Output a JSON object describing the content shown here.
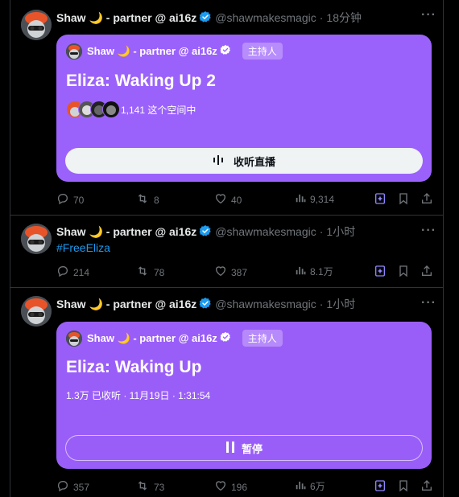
{
  "tweets": [
    {
      "name": "Shaw 🌙 - partner @ ai16z",
      "handle": "@shawmakesmagic",
      "time": "18分钟",
      "space": {
        "host": "Shaw 🌙 - partner @ ai16z",
        "badge": "主持人",
        "title": "Eliza: Waking Up 2",
        "listeners": "1,141 这个空间中",
        "button": "收听直播"
      },
      "stats": {
        "replies": "70",
        "retweets": "8",
        "likes": "40",
        "views": "9,314"
      }
    },
    {
      "name": "Shaw 🌙 - partner @ ai16z",
      "handle": "@shawmakesmagic",
      "time": "1小时",
      "text": "#FreeEliza",
      "stats": {
        "replies": "214",
        "retweets": "78",
        "likes": "387",
        "views": "8.1万"
      }
    },
    {
      "name": "Shaw 🌙 - partner @ ai16z",
      "handle": "@shawmakesmagic",
      "time": "1小时",
      "space": {
        "host": "Shaw 🌙 - partner @ ai16z",
        "badge": "主持人",
        "title": "Eliza: Waking Up",
        "meta": "1.3万 已收听 · 11月19日 · 1:31:54",
        "button": "暂停"
      },
      "stats": {
        "replies": "357",
        "retweets": "73",
        "likes": "196",
        "views": "6万"
      }
    }
  ],
  "colors": {
    "space_purple": "#9b62fb",
    "link_blue": "#1d9bf0",
    "verified_blue": "#1d9bf0",
    "grok_purple": "#8f86ff"
  },
  "icons": [
    "more-icon",
    "verified-badge-icon",
    "reply-icon",
    "retweet-icon",
    "like-icon",
    "views-icon",
    "grok-icon",
    "bookmark-icon",
    "share-icon",
    "audio-wave-icon",
    "pause-icon"
  ]
}
